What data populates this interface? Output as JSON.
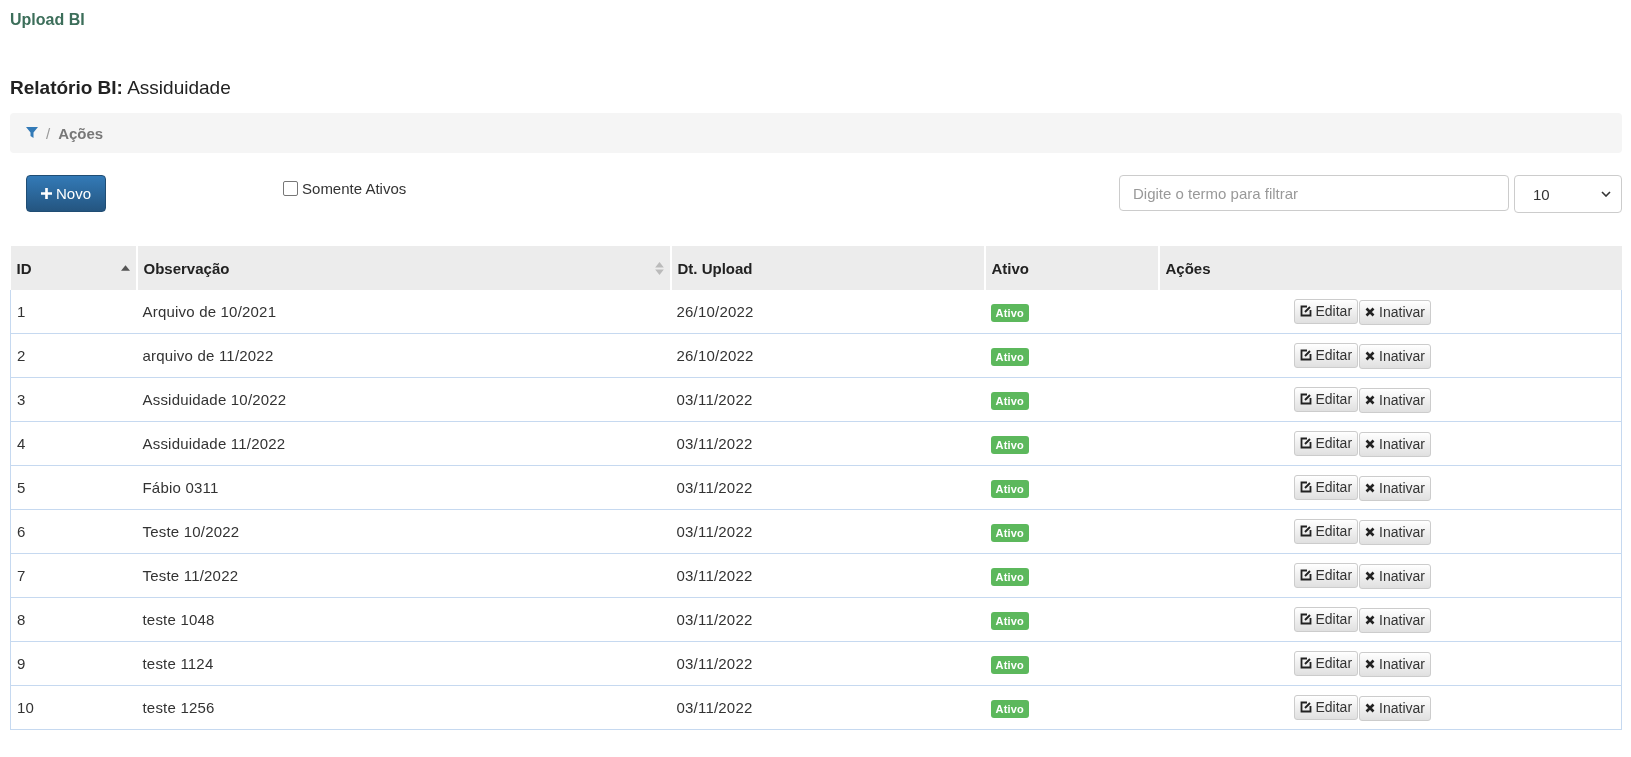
{
  "app_title": "Upload BI",
  "heading": {
    "label": "Relatório BI:",
    "value": "Assiduidade"
  },
  "breadcrumb": {
    "separator": "/",
    "current": "Ações"
  },
  "toolbar": {
    "new_button": "Novo",
    "only_active": {
      "label": "Somente Ativos",
      "checked": false
    },
    "search": {
      "placeholder": "Digite o termo para filtrar"
    },
    "page_size": "10"
  },
  "table": {
    "columns": [
      {
        "label": "ID",
        "sortable": true,
        "sorted": true
      },
      {
        "label": "Observação",
        "sortable": true,
        "sorted": false
      },
      {
        "label": "Dt. Upload",
        "sortable": false,
        "sorted": false
      },
      {
        "label": "Ativo",
        "sortable": false,
        "sorted": false
      },
      {
        "label": "Ações",
        "sortable": false,
        "sorted": false
      }
    ],
    "rows": [
      {
        "id": "1",
        "observation": "Arquivo de 10/2021",
        "date": "26/10/2022",
        "status": "Ativo",
        "actions": [
          "Editar",
          "Inativar"
        ]
      },
      {
        "id": "2",
        "observation": "arquivo de 11/2022",
        "date": "26/10/2022",
        "status": "Ativo",
        "actions": [
          "Editar",
          "Inativar"
        ]
      },
      {
        "id": "3",
        "observation": "Assiduidade 10/2022",
        "date": "03/11/2022",
        "status": "Ativo",
        "actions": [
          "Editar",
          "Inativar"
        ]
      },
      {
        "id": "4",
        "observation": "Assiduidade 11/2022",
        "date": "03/11/2022",
        "status": "Ativo",
        "actions": [
          "Editar",
          "Inativar"
        ]
      },
      {
        "id": "5",
        "observation": "Fábio 0311",
        "date": "03/11/2022",
        "status": "Ativo",
        "actions": [
          "Editar",
          "Inativar"
        ]
      },
      {
        "id": "6",
        "observation": "Teste 10/2022",
        "date": "03/11/2022",
        "status": "Ativo",
        "actions": [
          "Editar",
          "Inativar"
        ]
      },
      {
        "id": "7",
        "observation": "Teste 11/2022",
        "date": "03/11/2022",
        "status": "Ativo",
        "actions": [
          "Editar",
          "Inativar"
        ]
      },
      {
        "id": "8",
        "observation": "teste 1048",
        "date": "03/11/2022",
        "status": "Ativo",
        "actions": [
          "Editar",
          "Inativar"
        ]
      },
      {
        "id": "9",
        "observation": "teste 1124",
        "date": "03/11/2022",
        "status": "Ativo",
        "actions": [
          "Editar",
          "Inativar"
        ]
      },
      {
        "id": "10",
        "observation": "teste 1256",
        "date": "03/11/2022",
        "status": "Ativo",
        "actions": [
          "Editar",
          "Inativar"
        ]
      }
    ]
  }
}
